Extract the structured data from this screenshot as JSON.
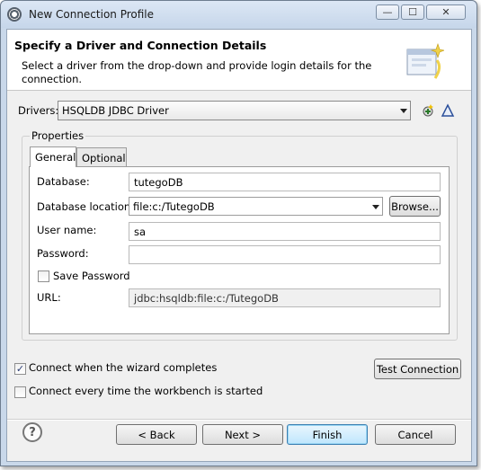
{
  "window": {
    "title": "New Connection Profile",
    "controls": {
      "minimize": "—",
      "maximize": "☐",
      "close": "✕"
    }
  },
  "banner": {
    "title": "Specify a Driver and Connection Details",
    "description": "Select a driver from the drop-down and provide login details for the connection."
  },
  "drivers": {
    "label": "Drivers:",
    "selected": "HSQLDB JDBC Driver",
    "icons": [
      "new-driver-icon",
      "edit-driver-icon"
    ]
  },
  "properties": {
    "group_title": "Properties",
    "tabs": [
      {
        "label": "General",
        "active": true
      },
      {
        "label": "Optional",
        "active": false
      }
    ],
    "fields": {
      "database": {
        "label": "Database:",
        "value": "tutegoDB"
      },
      "database_location": {
        "label": "Database location:",
        "value": "file:c:/TutegoDB",
        "browse_label": "Browse..."
      },
      "user_name": {
        "label": "User name:",
        "value": "sa"
      },
      "password": {
        "label": "Password:",
        "value": ""
      },
      "save_password": {
        "label": "Save Password",
        "checked": false
      },
      "url": {
        "label": "URL:",
        "value": "jdbc:hsqldb:file:c:/TutegoDB"
      }
    }
  },
  "options": {
    "connect_when_complete": {
      "label": "Connect when the wizard completes",
      "checked": true
    },
    "connect_every_time": {
      "label": "Connect every time the workbench is started",
      "checked": false
    },
    "test_connection_label": "Test Connection"
  },
  "footer": {
    "help": "?",
    "back_label": "< Back",
    "next_label": "Next >",
    "finish_label": "Finish",
    "cancel_label": "Cancel"
  },
  "colors": {
    "title_bar": "#c6d6ea",
    "dialog_bg": "#f0f0f0",
    "default_button": "#bee6fd"
  }
}
